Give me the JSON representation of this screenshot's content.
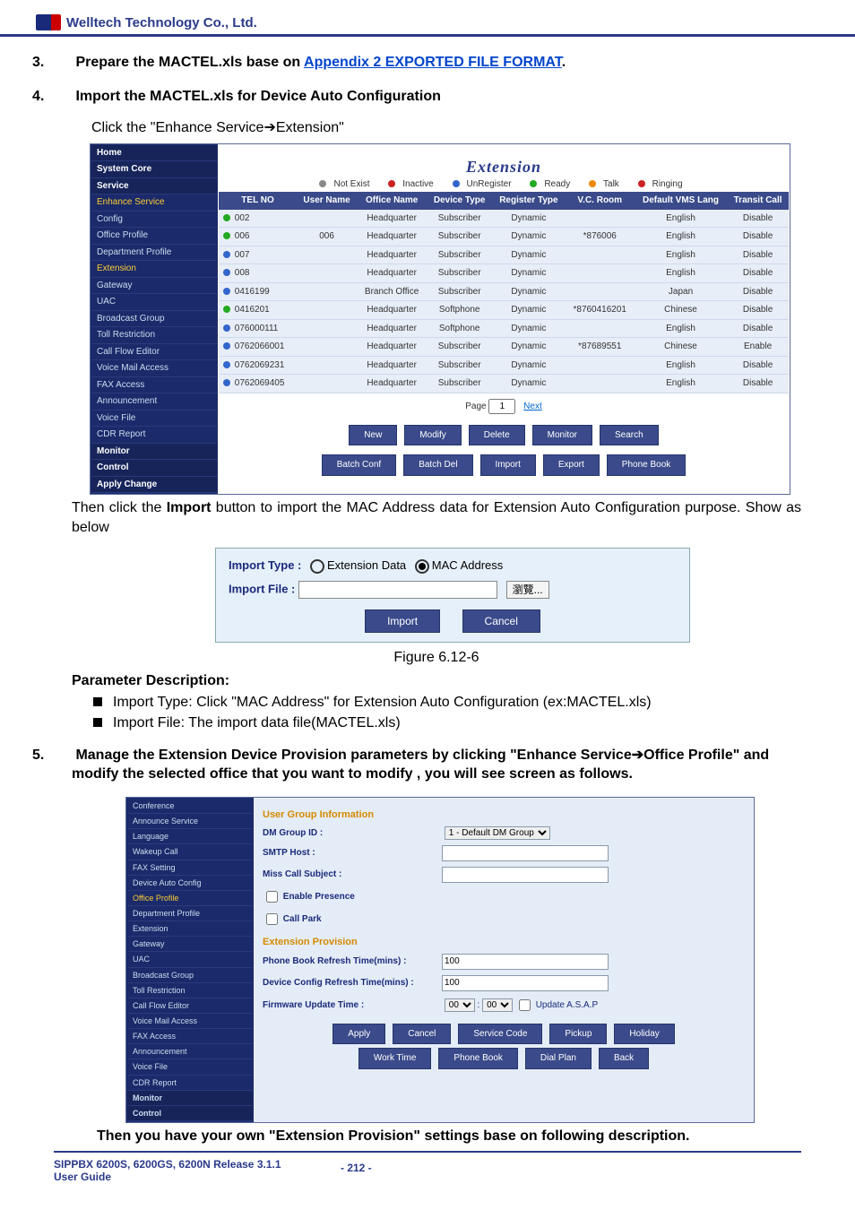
{
  "header": {
    "company": "Welltech Technology Co., Ltd."
  },
  "step3": {
    "num": "3.",
    "text_a": "Prepare the MACTEL.xls base on ",
    "link": "Appendix 2 EXPORTED FILE FORMAT",
    "text_b": "."
  },
  "step4": {
    "num": "4.",
    "title": "Import the MACTEL.xls for Device Auto Configuration",
    "subline": "Click the \"Enhance Service➔Extension\""
  },
  "shot1": {
    "sidebar": {
      "home": "Home",
      "system_core": "System Core",
      "service": "Service",
      "enhance": "Enhance Service",
      "items": [
        "Config",
        "Office Profile",
        "Department Profile",
        "Extension",
        "Gateway",
        "UAC",
        "Broadcast Group",
        "Toll Restriction",
        "Call Flow Editor",
        "Voice Mail Access",
        "FAX Access",
        "Announcement",
        "Voice File",
        "CDR Report"
      ],
      "monitor": "Monitor",
      "control": "Control",
      "apply": "Apply Change"
    },
    "title": "Extension",
    "legend": {
      "not_exist": "Not Exist",
      "inactive": "Inactive",
      "unregister": "UnRegister",
      "ready": "Ready",
      "talk": "Talk",
      "ringing": "Ringing"
    },
    "columns": [
      "TEL NO",
      "User Name",
      "Office Name",
      "Device Type",
      "Register Type",
      "V.C. Room",
      "Default VMS Lang",
      "Transit Call"
    ],
    "rows": [
      {
        "tel": "002",
        "user": "",
        "office": "Headquarter",
        "dev": "Subscriber",
        "reg": "Dynamic",
        "vc": "",
        "lang": "English",
        "tc": "Disable",
        "dot": "d-green"
      },
      {
        "tel": "006",
        "user": "006",
        "office": "Headquarter",
        "dev": "Subscriber",
        "reg": "Dynamic",
        "vc": "*876006",
        "lang": "English",
        "tc": "Disable",
        "dot": "d-green"
      },
      {
        "tel": "007",
        "user": "",
        "office": "Headquarter",
        "dev": "Subscriber",
        "reg": "Dynamic",
        "vc": "",
        "lang": "English",
        "tc": "Disable",
        "dot": "d-blue"
      },
      {
        "tel": "008",
        "user": "",
        "office": "Headquarter",
        "dev": "Subscriber",
        "reg": "Dynamic",
        "vc": "",
        "lang": "English",
        "tc": "Disable",
        "dot": "d-blue"
      },
      {
        "tel": "0416199",
        "user": "",
        "office": "Branch Office",
        "dev": "Subscriber",
        "reg": "Dynamic",
        "vc": "",
        "lang": "Japan",
        "tc": "Disable",
        "dot": "d-blue"
      },
      {
        "tel": "0416201",
        "user": "",
        "office": "Headquarter",
        "dev": "Softphone",
        "reg": "Dynamic",
        "vc": "*8760416201",
        "lang": "Chinese",
        "tc": "Disable",
        "dot": "d-green"
      },
      {
        "tel": "076000111",
        "user": "",
        "office": "Headquarter",
        "dev": "Softphone",
        "reg": "Dynamic",
        "vc": "",
        "lang": "English",
        "tc": "Disable",
        "dot": "d-blue"
      },
      {
        "tel": "0762066001",
        "user": "",
        "office": "Headquarter",
        "dev": "Subscriber",
        "reg": "Dynamic",
        "vc": "*87689551",
        "lang": "Chinese",
        "tc": "Enable",
        "dot": "d-blue"
      },
      {
        "tel": "0762069231",
        "user": "",
        "office": "Headquarter",
        "dev": "Subscriber",
        "reg": "Dynamic",
        "vc": "",
        "lang": "English",
        "tc": "Disable",
        "dot": "d-blue"
      },
      {
        "tel": "0762069405",
        "user": "",
        "office": "Headquarter",
        "dev": "Subscriber",
        "reg": "Dynamic",
        "vc": "",
        "lang": "English",
        "tc": "Disable",
        "dot": "d-blue"
      }
    ],
    "pager": {
      "label": "Page",
      "value": "1",
      "next": "Next"
    },
    "buttons1": [
      "New",
      "Modify",
      "Delete",
      "Monitor",
      "Search"
    ],
    "buttons2": [
      "Batch Conf",
      "Batch Del",
      "Import",
      "Export",
      "Phone Book"
    ]
  },
  "after_shot1": "Then click the Import button to import the MAC Address data for Extension Auto Configuration purpose. Show as below",
  "import_box": {
    "type_label": "Import Type :",
    "opt1": "Extension Data",
    "opt2": "MAC Address",
    "file_label": "Import File :",
    "browse": "瀏覽...",
    "btn_import": "Import",
    "btn_cancel": "Cancel"
  },
  "figure": "Figure 6.12-6",
  "param_head": "Parameter Description:",
  "bullets": [
    "Import Type: Click \"MAC Address\" for Extension Auto Configuration (ex:MACTEL.xls)",
    "Import File: The import data file(MACTEL.xls)"
  ],
  "step5": {
    "num": "5.",
    "text": "Manage the Extension Device Provision parameters by clicking \"Enhance Service➔Office Profile\" and modify the selected office that you want to modify , you will see screen as follows."
  },
  "shot2": {
    "sidebar": [
      "Conference",
      "Announce Service",
      "Language",
      "Wakeup Call",
      "FAX Setting",
      "Device Auto Config",
      "Office Profile",
      "Department Profile",
      "Extension",
      "Gateway",
      "UAC",
      "Broadcast Group",
      "Toll Restriction",
      "Call Flow Editor",
      "Voice Mail Access",
      "FAX Access",
      "Announcement",
      "Voice File",
      "CDR Report",
      "Monitor",
      "Control"
    ],
    "group_title": "User Group Information",
    "dm_label": "DM Group ID :",
    "dm_value": "1 - Default DM Group",
    "smtp_label": "SMTP Host :",
    "miss_label": "Miss Call Subject :",
    "enable_presence": "Enable Presence",
    "call_park": "Call Park",
    "ext_prov": "Extension Provision",
    "pb_label": "Phone Book Refresh Time(mins) :",
    "pb_value": "100",
    "dc_label": "Device Config Refresh Time(mins) :",
    "dc_value": "100",
    "fw_label": "Firmware Update Time :",
    "fw_h": "00",
    "fw_m": "00",
    "update_chk": "Update A.S.A.P",
    "buttons1": [
      "Apply",
      "Cancel",
      "Service Code",
      "Pickup",
      "Holiday"
    ],
    "buttons2": [
      "Work Time",
      "Phone Book",
      "Dial Plan",
      "Back"
    ]
  },
  "after_shot2": "Then you have your own \"Extension Provision\" settings base on following description.",
  "footer": {
    "l1": "SIPPBX 6200S, 6200GS, 6200N Release 3.1.1",
    "l2": "User Guide",
    "page": "- 212 -"
  }
}
